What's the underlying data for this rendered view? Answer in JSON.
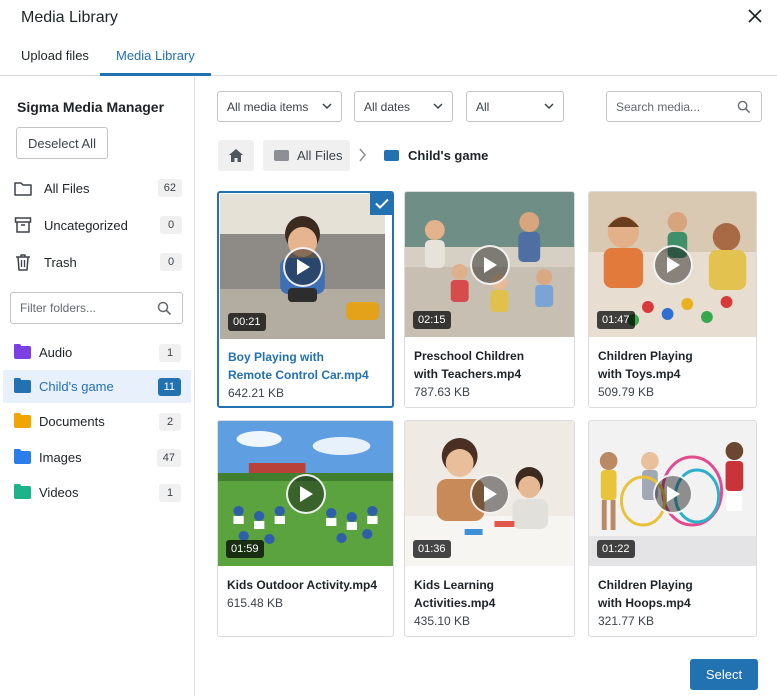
{
  "window": {
    "title": "Media Library"
  },
  "tabs": [
    {
      "label": "Upload files",
      "active": false
    },
    {
      "label": "Media Library",
      "active": true
    }
  ],
  "sidebar": {
    "title": "Sigma Media Manager",
    "deselect_label": "Deselect All",
    "system_items": [
      {
        "label": "All Files",
        "count": "62",
        "icon": "folder-outline-icon"
      },
      {
        "label": "Uncategorized",
        "count": "0",
        "icon": "archive-box-icon"
      },
      {
        "label": "Trash",
        "count": "0",
        "icon": "trash-icon"
      }
    ],
    "filter_placeholder": "Filter folders...",
    "folders": [
      {
        "label": "Audio",
        "count": "1",
        "color": "#7b3fe4",
        "active": false
      },
      {
        "label": "Child's game",
        "count": "11",
        "color": "#2271b1",
        "active": true
      },
      {
        "label": "Documents",
        "count": "2",
        "color": "#f0a500",
        "active": false
      },
      {
        "label": "Images",
        "count": "47",
        "color": "#2b7de9",
        "active": false
      },
      {
        "label": "Videos",
        "count": "1",
        "color": "#1db38a",
        "active": false
      }
    ]
  },
  "toolbar": {
    "type_filter": "All media items",
    "date_filter": "All dates",
    "third_filter": "All",
    "search_placeholder": "Search media..."
  },
  "breadcrumb": {
    "all_files": "All Files",
    "current": "Child's game"
  },
  "media": [
    {
      "name_line1": "Boy Playing with",
      "name_line2": "Remote Control Car.mp4",
      "size": "642.21 KB",
      "duration": "00:21",
      "selected": true
    },
    {
      "name_line1": "Preschool Children",
      "name_line2": "with Teachers.mp4",
      "size": "787.63 KB",
      "duration": "02:15",
      "selected": false
    },
    {
      "name_line1": "Children Playing",
      "name_line2": "with Toys.mp4",
      "size": "509.79 KB",
      "duration": "01:47",
      "selected": false
    },
    {
      "name_line1": "Kids Outdoor Activity.mp4",
      "name_line2": "",
      "size": "615.48 KB",
      "duration": "01:59",
      "selected": false
    },
    {
      "name_line1": "Kids Learning",
      "name_line2": "Activities.mp4",
      "size": "435.10 KB",
      "duration": "01:36",
      "selected": false
    },
    {
      "name_line1": "Children Playing",
      "name_line2": "with Hoops.mp4",
      "size": "321.77 KB",
      "duration": "01:22",
      "selected": false
    }
  ],
  "footer": {
    "select_label": "Select"
  },
  "colors": {
    "accent": "#2271b1",
    "border": "#dcdcde",
    "badge_bg": "#f0f0f1"
  }
}
